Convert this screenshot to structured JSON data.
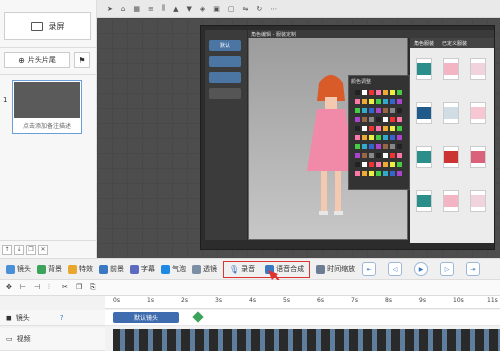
{
  "sidebar": {
    "record_label": "录屏",
    "head_tail_label": "片头片尾",
    "slide_number": "1",
    "slide_caption": "点击添加备注描述"
  },
  "stage": {
    "title": "角色编辑 - 服装定制",
    "left_buttons": [
      "默认",
      "",
      "",
      ""
    ],
    "right_tabs": [
      "角色服装",
      "已定义服装"
    ],
    "palette_title": "颜色调整"
  },
  "toolbar": {
    "tools": [
      {
        "label": "镜头",
        "icon": "camera-icon"
      },
      {
        "label": "背景",
        "icon": "image-icon"
      },
      {
        "label": "特效",
        "icon": "sparkle-icon"
      },
      {
        "label": "前景",
        "icon": "layer-icon"
      },
      {
        "label": "字幕",
        "icon": "caption-icon"
      },
      {
        "label": "气泡",
        "icon": "bubble-icon"
      },
      {
        "label": "透镜",
        "icon": "lens-icon"
      }
    ],
    "highlight": [
      {
        "label": "录音",
        "icon": "mic-icon"
      },
      {
        "label": "语音合成",
        "icon": "tts-icon"
      }
    ],
    "after": [
      {
        "label": "时间缩放",
        "icon": "zoom-time-icon"
      }
    ]
  },
  "timeline": {
    "ticks": [
      "0s",
      "1s",
      "2s",
      "3s",
      "4s",
      "5s",
      "6s",
      "7s",
      "8s",
      "9s",
      "10s",
      "11s"
    ],
    "tracks": [
      {
        "label": "镜头",
        "clip": "默认镜头"
      },
      {
        "label": "视频",
        "clip": ""
      }
    ]
  },
  "colors": {
    "accent": "#3f6cae",
    "highlight_border": "#d33333",
    "dark_canvas": "#4d4d4d"
  }
}
